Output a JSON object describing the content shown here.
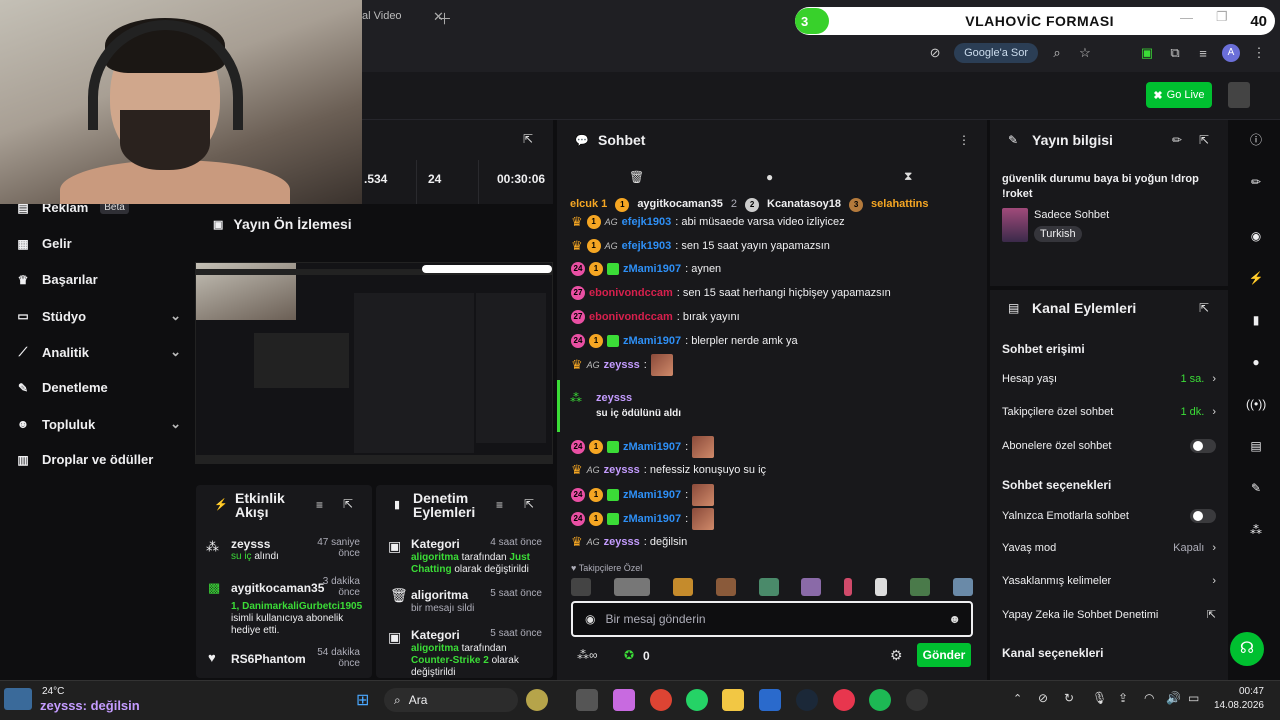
{
  "browser": {
    "tab_partial": "al Video",
    "google_sor": "Google'a Sor",
    "profile_letter": "A"
  },
  "banner": {
    "badge": "3",
    "title": "VLAHOVİC FORMASI",
    "count": "40"
  },
  "appbar": {
    "go_live": "Go Live"
  },
  "stats": {
    "s1": ".534",
    "s2": "24",
    "s3": "00:30:06"
  },
  "sidebar": {
    "items": [
      {
        "label": "Reklam",
        "badge": "Beta",
        "icon": "ad-icon"
      },
      {
        "label": "Gelir",
        "icon": "revenue-icon"
      },
      {
        "label": "Başarılar",
        "icon": "trophy-icon"
      },
      {
        "label": "Stüdyo",
        "icon": "studio-icon"
      },
      {
        "label": "Analitik",
        "icon": "analytics-icon"
      },
      {
        "label": "Denetleme",
        "icon": "wrench-icon"
      },
      {
        "label": "Topluluk",
        "icon": "community-icon"
      },
      {
        "label": "Droplar ve ödüller",
        "icon": "drops-icon"
      }
    ]
  },
  "preview": {
    "title": "Yayın Ön İzlemesi"
  },
  "activity": {
    "title": "Etkinlik Akışı",
    "items": [
      {
        "name": "zeysss",
        "detail": "su iç",
        "detail2": "alındı",
        "time": "47 saniye önce"
      },
      {
        "name": "aygitkocaman35",
        "detail": "1, DanimarkaliGurbetci1905",
        "detail2": "isimli kullanıcıya abonelik hediye etti.",
        "time": "3 dakika önce"
      },
      {
        "name": "RS6Phantom",
        "time": "54 dakika önce"
      }
    ]
  },
  "modactions": {
    "title": "Denetim Eylemleri",
    "items": [
      {
        "name": "Kategori",
        "time": "4 saat önce",
        "actor": "aligoritma",
        "text1": "tarafından",
        "hl": "Just Chatting",
        "text2": "olarak değiştirildi"
      },
      {
        "name": "aligoritma",
        "time": "5 saat önce",
        "text1": "bir mesajı sildi"
      },
      {
        "name": "Kategori",
        "time": "5 saat önce",
        "actor": "aligoritma",
        "text1": "tarafından",
        "hl": "Counter-Strike 2",
        "text2": "olarak değiştirildi"
      }
    ]
  },
  "chat": {
    "title": "Sohbet",
    "pinned": [
      {
        "name": "elcuk 1",
        "n": ""
      },
      {
        "name": "aygitkocaman35",
        "n": "2"
      },
      {
        "name": "Kcanatasoy18",
        "n": ""
      },
      {
        "name": "selahattins",
        "n": ""
      }
    ],
    "messages": [
      {
        "user": "efejk1903",
        "text": ": abi müsaede varsa video izliyicez",
        "color": "#2e8ff5"
      },
      {
        "user": "efejk1903",
        "text": ": sen 15 saat yayın yapamazsın",
        "color": "#2e8ff5"
      },
      {
        "user": "zMami1907",
        "text": ": aynen",
        "color": "#2e8ff5"
      },
      {
        "user": "ebonivondccam",
        "text": ": sen 15 saat herhangi hiçbişey yapamazsın",
        "color": "#d6204d"
      },
      {
        "user": "ebonivondccam",
        "text": ": bırak yayını",
        "color": "#d6204d"
      },
      {
        "user": "zMami1907",
        "text": ": blerpler nerde amk ya",
        "color": "#2e8ff5"
      },
      {
        "user": "zeysss",
        "text": ":",
        "color": "#c49cff"
      }
    ],
    "reward_user": "zeysss",
    "reward_text": "su iç ödülünü aldı",
    "messages2": [
      {
        "user": "zMami1907",
        "text": ":",
        "color": "#2e8ff5"
      },
      {
        "user": "zeysss",
        "text": ": nefessiz konuşuyo su iç",
        "color": "#c49cff"
      },
      {
        "user": "zMami1907",
        "text": ":",
        "color": "#2e8ff5"
      },
      {
        "user": "zMami1907",
        "text": ":",
        "color": "#2e8ff5"
      },
      {
        "user": "zeysss",
        "text": ": değilsin",
        "color": "#c49cff"
      }
    ],
    "followers_only": "Takipçilere Özel",
    "placeholder": "Bir mesaj gönderin",
    "points": "0",
    "send": "Gönder"
  },
  "info": {
    "title": "Yayın bilgisi",
    "stream_title": "güvenlik durumu baya bi yoğun !drop !roket",
    "category": "Sadece Sohbet",
    "tag": "Turkish"
  },
  "channel_actions": {
    "title": "Kanal Eylemleri",
    "section1": "Sohbet erişimi",
    "account_age": {
      "label": "Hesap yaşı",
      "value": "1 sa."
    },
    "followers_chat": {
      "label": "Takipçilere özel sohbet",
      "value": "1 dk."
    },
    "subs_chat": {
      "label": "Abonelere özel sohbet"
    },
    "section2": "Sohbet seçenekleri",
    "emote_only": {
      "label": "Yalnızca Emotlarla sohbet"
    },
    "slow_mode": {
      "label": "Yavaş mod",
      "value": "Kapalı"
    },
    "banned_words": {
      "label": "Yasaklanmış kelimeler"
    },
    "ai_mod": {
      "label": "Yapay Zeka ile Sohbet Denetimi"
    },
    "section3": "Kanal seçenekleri"
  },
  "taskbar": {
    "temp": "24°C",
    "ticker": "zeysss: değilsin",
    "search": "Ara",
    "time": "00:47",
    "date": "14.08.2026"
  }
}
